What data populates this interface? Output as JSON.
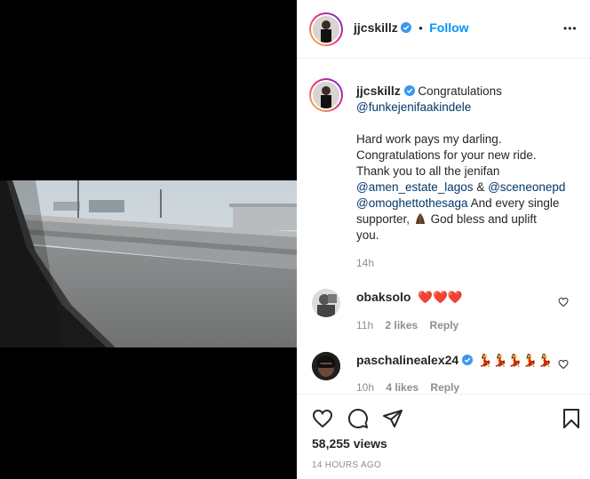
{
  "post": {
    "author": "jjcskillz",
    "follow_label": "Follow",
    "dot": "•",
    "more_label": "•••",
    "caption": {
      "author": "jjcskillz",
      "line1_text": "Congratulations",
      "mention_funke": "@funkejenifaakindele",
      "line3": "Hard work pays my darling.",
      "line4": "Congratulations for your new ride.",
      "line5": "Thank you to all the jenifan",
      "mention_amen": "@amen_estate_lagos",
      "amp": "&",
      "mention_scene": "@sceneonepd",
      "mention_omo": "@omoghettothesaga",
      "line7_tail": "And every single",
      "line8_start": "supporter,",
      "line8_tail": "God bless and uplift",
      "line9": "you.",
      "time": "14h"
    },
    "comments": [
      {
        "user": "obaksolo",
        "text": "❤️❤️❤️",
        "time": "11h",
        "likes": "2 likes",
        "reply": "Reply"
      },
      {
        "user": "paschalinealex24",
        "text": "💃💃💃💃💃",
        "time": "10h",
        "likes": "4 likes",
        "reply": "Reply"
      }
    ],
    "views": "58,255 views",
    "timestamp": "14 HOURS AGO"
  },
  "icons": {
    "like": "heart-icon",
    "comment": "comment-icon",
    "share": "paper-plane-icon",
    "save": "bookmark-icon",
    "verified": "verified-badge-icon",
    "more": "more-options-icon"
  },
  "colors": {
    "accent": "#0095f6",
    "heart": "#ed4956",
    "link": "#00376b",
    "muted": "#8e8e8e",
    "verified": "#3897f0"
  }
}
